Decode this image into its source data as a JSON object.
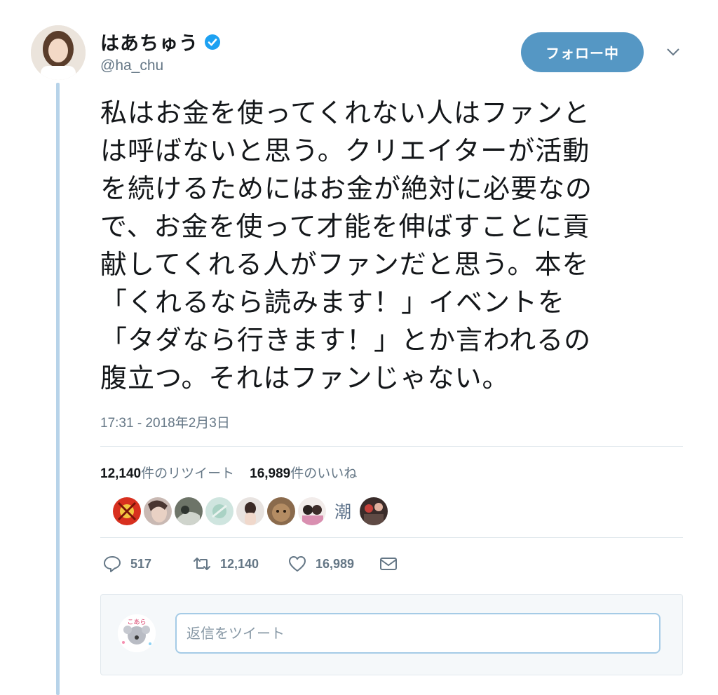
{
  "author": {
    "name": "はあちゅう",
    "handle": "@ha_chu",
    "verified": true
  },
  "follow_button": {
    "label": "フォロー中"
  },
  "tweet": {
    "text": "私はお金を使ってくれない人はファンと\nは呼ばないと思う。クリエイターが活動\nを続けるためにはお金が絶対に必要なの\nで、お金を使って才能を伸ばすことに貢\n献してくれる人がファンだと思う。本を\n「くれるなら読みます！」イベントを\n「タダなら行きます！」とか言われるの\n腹立つ。それはファンじゃない。",
    "timestamp": "17:31 - 2018年2月3日"
  },
  "stats": {
    "retweets_count": "12,140",
    "retweets_label": "件のリツイート",
    "likes_count": "16,989",
    "likes_label": "件のいいね"
  },
  "likers": [
    {
      "icon": "red-badge"
    },
    {
      "icon": "photo"
    },
    {
      "icon": "photo"
    },
    {
      "icon": "photo"
    },
    {
      "icon": "photo"
    },
    {
      "icon": "photo"
    },
    {
      "icon": "photo"
    },
    {
      "icon": "kanji-text"
    },
    {
      "icon": "photo"
    }
  ],
  "liker_kanji": "潮",
  "reply_avatar_label": "こあら",
  "actions": {
    "reply_count": "517",
    "retweet_count": "12,140",
    "like_count": "16,989"
  },
  "reply": {
    "placeholder": "返信をツイート"
  },
  "colors": {
    "accent": "#5597c4",
    "verified": "#1da1f2",
    "thread_line": "#b7d3e9",
    "muted_text": "#657786"
  }
}
